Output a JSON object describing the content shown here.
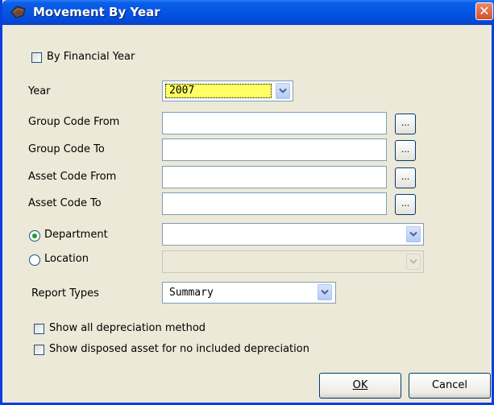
{
  "window": {
    "title": "Movement By Year",
    "close_symbol": "✕"
  },
  "form": {
    "by_financial_year": {
      "label": "By Financial Year",
      "checked": false
    },
    "year": {
      "label": "Year",
      "value": "2007"
    },
    "group_code_from": {
      "label": "Group Code From",
      "value": "",
      "browse": "..."
    },
    "group_code_to": {
      "label": "Group Code To",
      "value": "",
      "browse": "..."
    },
    "asset_code_from": {
      "label": "Asset Code From",
      "value": "",
      "browse": "..."
    },
    "asset_code_to": {
      "label": "Asset Code To",
      "value": "",
      "browse": "..."
    },
    "department": {
      "label": "Department",
      "selected": true,
      "value": ""
    },
    "location": {
      "label": "Location",
      "selected": false,
      "value": "",
      "disabled": true
    },
    "report_types": {
      "label": "Report Types",
      "value": "Summary"
    },
    "show_all_depreciation": {
      "label": "Show all depreciation method",
      "checked": false
    },
    "show_disposed": {
      "label": "Show disposed asset for no included depreciation",
      "checked": false
    }
  },
  "buttons": {
    "ok": "OK",
    "cancel": "Cancel"
  },
  "colors": {
    "titlebar": "#0554e3",
    "face": "#ece9d8",
    "year_highlight": "#ffff66"
  }
}
